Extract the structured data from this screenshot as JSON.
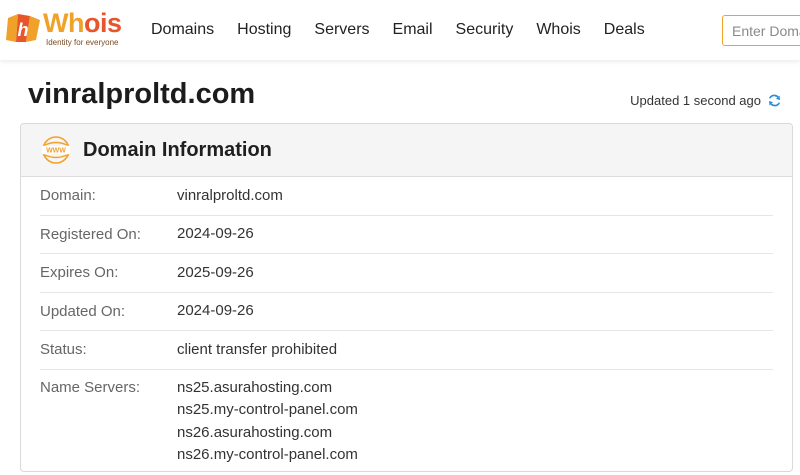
{
  "brand": {
    "name_part1": "Wh",
    "name_part2": "ois",
    "tagline": "Identity for everyone"
  },
  "nav": {
    "items": [
      "Domains",
      "Hosting",
      "Servers",
      "Email",
      "Security",
      "Whois",
      "Deals"
    ]
  },
  "search": {
    "placeholder": "Enter Domain"
  },
  "page": {
    "title": "vinralproltd.com",
    "updated": "Updated 1 second ago"
  },
  "card": {
    "title": "Domain Information",
    "icon_text": "WWW",
    "rows": [
      {
        "label": "Domain:",
        "value": "vinralproltd.com"
      },
      {
        "label": "Registered On:",
        "value": "2024-09-26"
      },
      {
        "label": "Expires On:",
        "value": "2025-09-26"
      },
      {
        "label": "Updated On:",
        "value": "2024-09-26"
      },
      {
        "label": "Status:",
        "value": "client transfer prohibited"
      }
    ],
    "name_servers": {
      "label": "Name Servers:",
      "values": [
        "ns25.asurahosting.com",
        "ns25.my-control-panel.com",
        "ns26.asurahosting.com",
        "ns26.my-control-panel.com"
      ]
    }
  },
  "colors": {
    "brand_orange": "#f0a12a",
    "brand_red": "#e8552b",
    "refresh_blue": "#2a8fd6"
  },
  "icons": [
    "whois-logo-icon",
    "www-globe-icon",
    "refresh-icon"
  ]
}
